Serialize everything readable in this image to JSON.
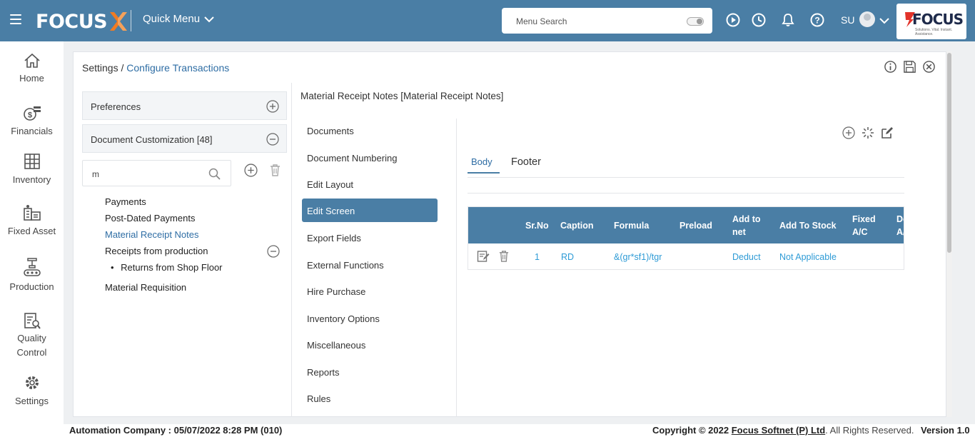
{
  "topbar": {
    "logo_text": "FOCUS",
    "quick_menu_label": "Quick Menu",
    "search_placeholder": "Menu Search",
    "user_initials": "SU",
    "brand_text": "FOCUS",
    "brand_tagline": "Solutions. Vital. Instant. Assistance.",
    "icons": [
      "menu-icon",
      "play-icon",
      "clock-icon",
      "bell-icon",
      "help-icon",
      "chevron-down-icon"
    ]
  },
  "sidebar": {
    "items": [
      {
        "label": "Home",
        "icon": "home-icon"
      },
      {
        "label": "Financials",
        "icon": "financials-icon"
      },
      {
        "label": "Inventory",
        "icon": "inventory-icon"
      },
      {
        "label": "Fixed Asset",
        "icon": "fixed-asset-icon"
      },
      {
        "label": "Production",
        "icon": "production-icon"
      },
      {
        "label": "Quality Control",
        "icon": "quality-control-icon"
      },
      {
        "label": "Settings",
        "icon": "settings-icon"
      }
    ]
  },
  "breadcrumb": {
    "root": "Settings /",
    "current": "Configure Transactions"
  },
  "left": {
    "preferences_label": "Preferences",
    "doc_custom_label": "Document Customization [48]",
    "filter_value": "m",
    "tree": [
      {
        "label": "Payments"
      },
      {
        "label": "Post-Dated Payments"
      },
      {
        "label": "Material Receipt Notes",
        "active": true
      },
      {
        "label": "Receipts from production"
      },
      {
        "label": "Returns from Shop Floor",
        "child": true
      },
      {
        "label": "Material Requisition"
      }
    ]
  },
  "document_title": "Material Receipt Notes [Material Receipt Notes]",
  "menu": [
    "Documents",
    "Document Numbering",
    "Edit Layout",
    "Edit Screen",
    "Export Fields",
    "External Functions",
    "Hire Purchase",
    "Inventory Options",
    "Miscellaneous",
    "Reports",
    "Rules"
  ],
  "menu_selected": "Edit Screen",
  "tabs": {
    "body": "Body",
    "footer": "Footer"
  },
  "grid": {
    "headers": [
      "Sr.No",
      "Caption",
      "Formula",
      "Preload",
      "Add to net",
      "Add To Stock",
      "Fixed A/C",
      "De A/"
    ],
    "rows": [
      {
        "sr": "1",
        "caption": "RD",
        "formula": "&(gr*sf1)/tgr",
        "preload": "",
        "add_to_net": "Deduct",
        "add_to_stock": "Not Applicable",
        "fixed_ac": ""
      }
    ]
  },
  "footer": {
    "left": "Automation Company : 05/07/2022 8:28 PM (010)",
    "copyright": "Copyright © 2022",
    "company": "Focus Softnet (P) Ltd",
    "rights": ". All Rights Reserved.",
    "version": "Version 1.0"
  },
  "colors": {
    "accent": "#4a7ea5",
    "link": "#2e6da4",
    "value": "#2e9bd6",
    "brand_orange": "#f07b22"
  }
}
